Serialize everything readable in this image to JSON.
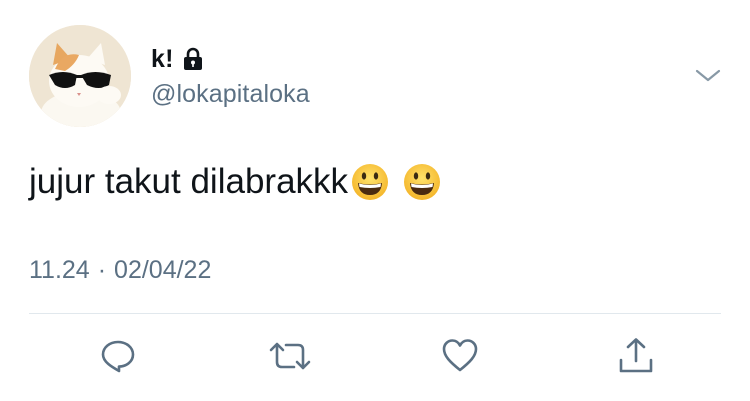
{
  "tweet": {
    "display_name": "k!",
    "handle": "@lokapitaloka",
    "protected_icon": "lock-icon",
    "text": "jujur takut dilabrakkk",
    "emojis": [
      "grinning-face-emoji",
      "grinning-face-emoji"
    ],
    "time": "11.24",
    "separator": "·",
    "date": "02/04/22"
  },
  "header": {
    "more_icon": "chevron-down-icon"
  },
  "actions": [
    {
      "name": "reply-icon"
    },
    {
      "name": "retweet-icon"
    },
    {
      "name": "like-icon"
    },
    {
      "name": "share-icon"
    }
  ],
  "colors": {
    "text_primary": "#0f1419",
    "text_secondary": "#5b7083",
    "icon": "#5b7083",
    "divider": "#e1e8ed"
  }
}
